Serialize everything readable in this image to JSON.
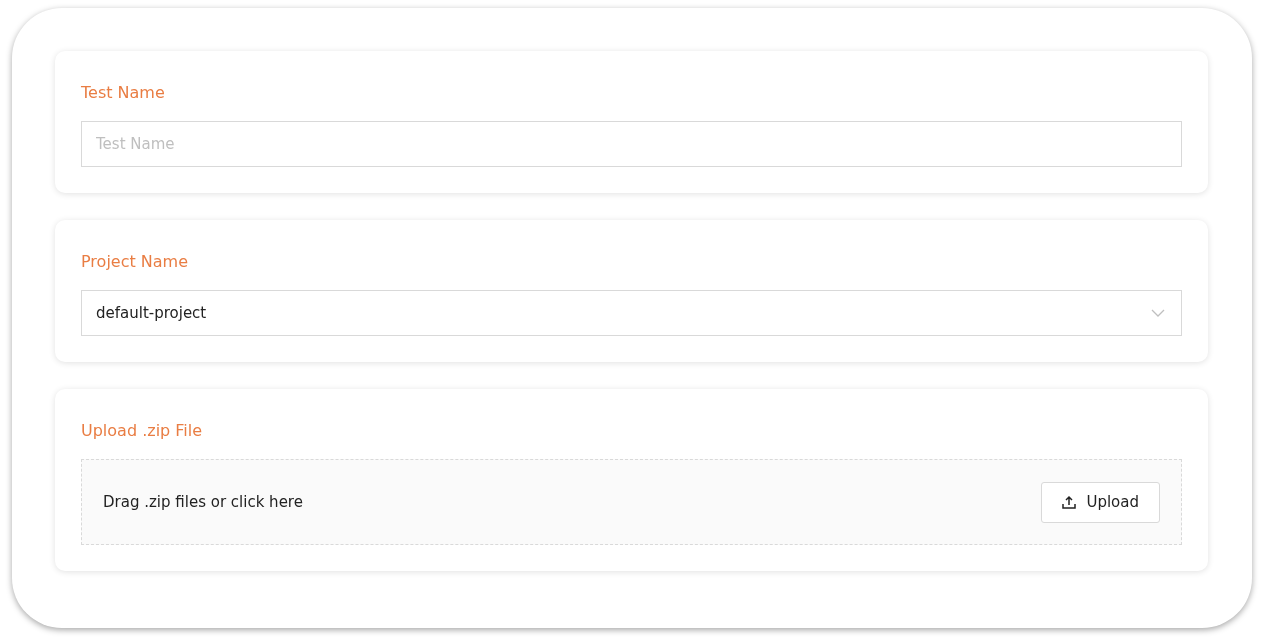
{
  "sections": [
    {
      "kind": "text",
      "label": "Test Name",
      "placeholder": "Test Name"
    },
    {
      "kind": "select",
      "label": "Project Name",
      "value": "default-project"
    },
    {
      "kind": "upload",
      "label": "Upload .zip File",
      "hint": "Drag .zip files or click here",
      "button": "Upload"
    }
  ]
}
